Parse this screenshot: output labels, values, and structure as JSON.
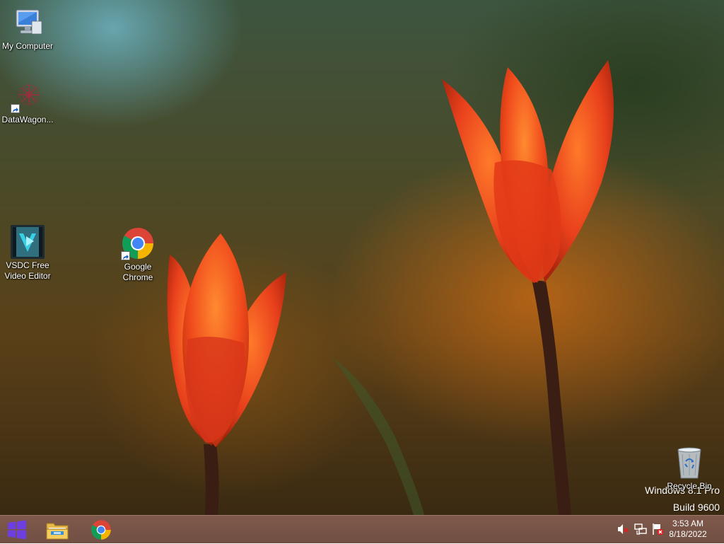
{
  "desktop": {
    "icons": {
      "my_computer": "My Computer",
      "datawagon": "DataWagon...",
      "vsdc": "VSDC Free\nVideo Editor",
      "chrome": "Google\nChrome",
      "recycle_bin": "Recycle Bin"
    },
    "watermark": {
      "line1": "Windows 8.1 Pro",
      "line2": "Build 9600"
    }
  },
  "taskbar": {
    "pinned": [
      "file-explorer",
      "google-chrome"
    ],
    "tray": [
      "volume-muted-icon",
      "network-icon",
      "action-center-flag-icon"
    ],
    "clock": {
      "time": "3:53 AM",
      "date": "8/18/2022"
    }
  },
  "colors": {
    "taskbar": "#734f42",
    "start_logo": "#6e3fe0",
    "tulip": "#e8401c"
  }
}
